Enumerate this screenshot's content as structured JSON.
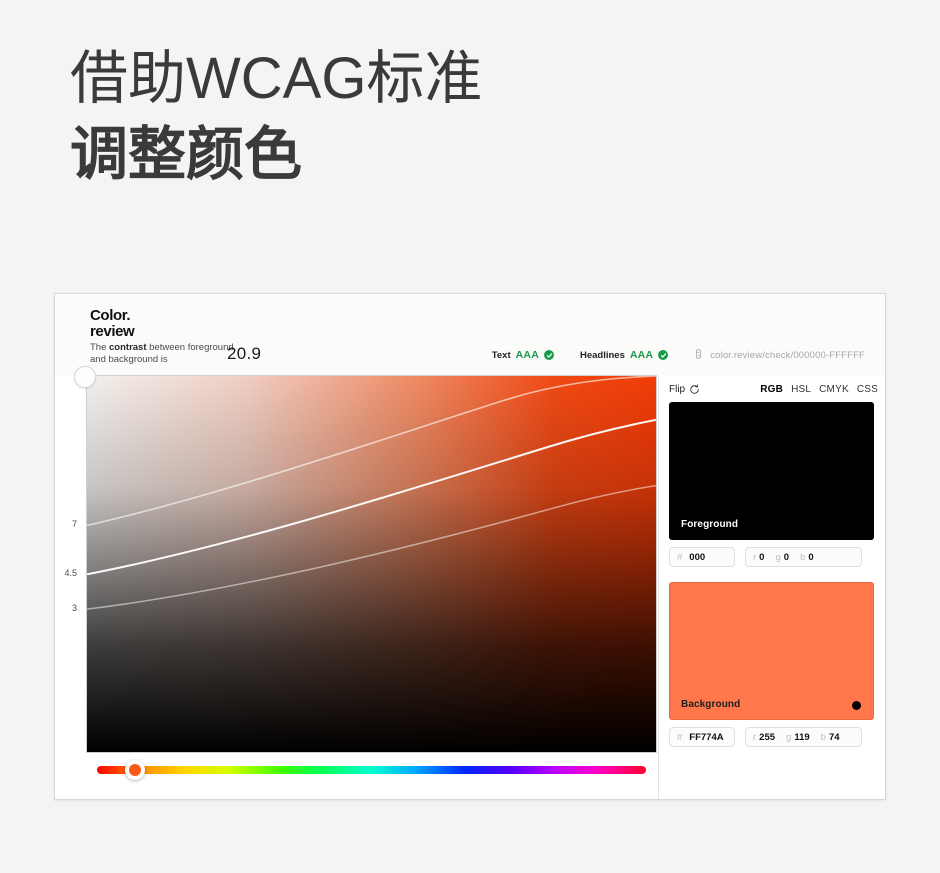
{
  "headline": {
    "line1": "借助WCAG标准",
    "line2": "调整颜色"
  },
  "app": {
    "logo_line1": "Color.",
    "logo_line2": "review",
    "contrast_text_pre": "The ",
    "contrast_text_bold": "contrast",
    "contrast_text_post": " between foreground and background is",
    "contrast_value": "20.9",
    "badges": [
      {
        "label": "Text",
        "level": "AAA",
        "icon": "check-circle-icon",
        "color": "#1a9a4b"
      },
      {
        "label": "Headlines",
        "level": "AAA",
        "icon": "check-circle-icon",
        "color": "#1a9a4b"
      }
    ],
    "url": "color.review/check/000000-FFFFFF",
    "link_icon": "link-icon"
  },
  "canvas": {
    "axis_labels": [
      "7",
      "4.5",
      "3"
    ],
    "axis_positions": [
      150,
      199,
      234
    ],
    "handle_name": "foreground-handle"
  },
  "hue_slider": {
    "value_percent": 7,
    "handle_color": "#fa5a14"
  },
  "panel": {
    "flip_label": "Flip",
    "flip_icon": "refresh-icon",
    "formats": [
      "RGB",
      "HSL",
      "CMYK",
      "CSS"
    ],
    "active_format": "RGB",
    "foreground": {
      "label": "Foreground",
      "swatch_color": "#000000",
      "hex_symbol": "#",
      "hex_value": "000",
      "channels": [
        {
          "key": "r",
          "value": "0"
        },
        {
          "key": "g",
          "value": "0"
        },
        {
          "key": "b",
          "value": "0"
        }
      ]
    },
    "background": {
      "label": "Background",
      "swatch_color": "#FF774A",
      "hex_symbol": "#",
      "hex_value": "FF774A",
      "channels": [
        {
          "key": "r",
          "value": "255"
        },
        {
          "key": "g",
          "value": "119"
        },
        {
          "key": "b",
          "value": "74"
        }
      ]
    }
  },
  "colors": {
    "page_bg": "#f4f4f3",
    "card_bg": "#ffffff",
    "accent_green": "#1a9a4b",
    "background_color": "#FF774A",
    "foreground_color": "#000000"
  }
}
